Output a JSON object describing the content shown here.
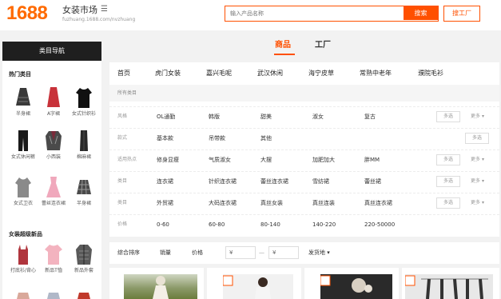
{
  "header": {
    "logo": "1688",
    "site_title": "女装市场",
    "site_domain": "fuzhuang.1688.com/nvzhuang",
    "search_placeholder": "输入产品名称",
    "search_button": "搜索",
    "factory_search_button": "搜工厂"
  },
  "tabs": [
    {
      "label": "商品",
      "active": true
    },
    {
      "label": "工厂",
      "active": false
    }
  ],
  "sidebar": {
    "title": "类目导航",
    "sections": [
      {
        "title": "热门类目",
        "items": [
          "半身裙",
          "A字裙",
          "女式针织衫",
          "女式休闲裤",
          "小西装",
          "棉麻裙",
          "女式卫衣",
          "蕾丝连衣裙",
          "半身裙"
        ]
      },
      {
        "title": "女装超级新品",
        "items": [
          "打底衫/背心",
          "新品T恤",
          "新品外套"
        ]
      }
    ]
  },
  "category_nav": [
    "首页",
    "虎门女装",
    "嘉兴毛呢",
    "武汉休闲",
    "海宁皮草",
    "常熟中老年",
    "濮院毛衫"
  ],
  "all_categories_label": "所有类目",
  "filters": [
    {
      "label": "风格",
      "values": [
        "OL通勤",
        "韩版",
        "甜美",
        "淑女",
        "复古"
      ],
      "multi": "多选",
      "more": "更多"
    },
    {
      "label": "款式",
      "values": [
        "基本款",
        "吊带款",
        "其他"
      ],
      "multi": "多选",
      "more": ""
    },
    {
      "label": "适用热点",
      "values": [
        "修身显瘦",
        "气质淑女",
        "大摆",
        "加肥加大",
        "胖MM"
      ],
      "multi": "多选",
      "more": "更多"
    },
    {
      "label": "类目",
      "values": [
        "连衣裙",
        "针织连衣裙",
        "蕾丝连衣裙",
        "雪纺裙",
        "蕾丝裙"
      ],
      "multi": "多选",
      "more": "更多"
    },
    {
      "label": "类目",
      "values": [
        "外贸裙",
        "大码连衣裙",
        "真丝女装",
        "真丝连装",
        "真丝连衣裙"
      ],
      "multi": "多选",
      "more": "更多"
    },
    {
      "label": "价格",
      "values": [
        "0-60",
        "60-80",
        "80-140",
        "140-220",
        "220-50000"
      ],
      "multi": "",
      "more": ""
    }
  ],
  "sort_bar": {
    "items": [
      "综合排序",
      "销量",
      "价格"
    ],
    "price_min_placeholder": "¥",
    "price_max_placeholder": "¥",
    "dash": "—",
    "ship_from": "发货地"
  },
  "colors": {
    "accent": "#ff5000",
    "sidebar_header": "#1f1f1f"
  }
}
